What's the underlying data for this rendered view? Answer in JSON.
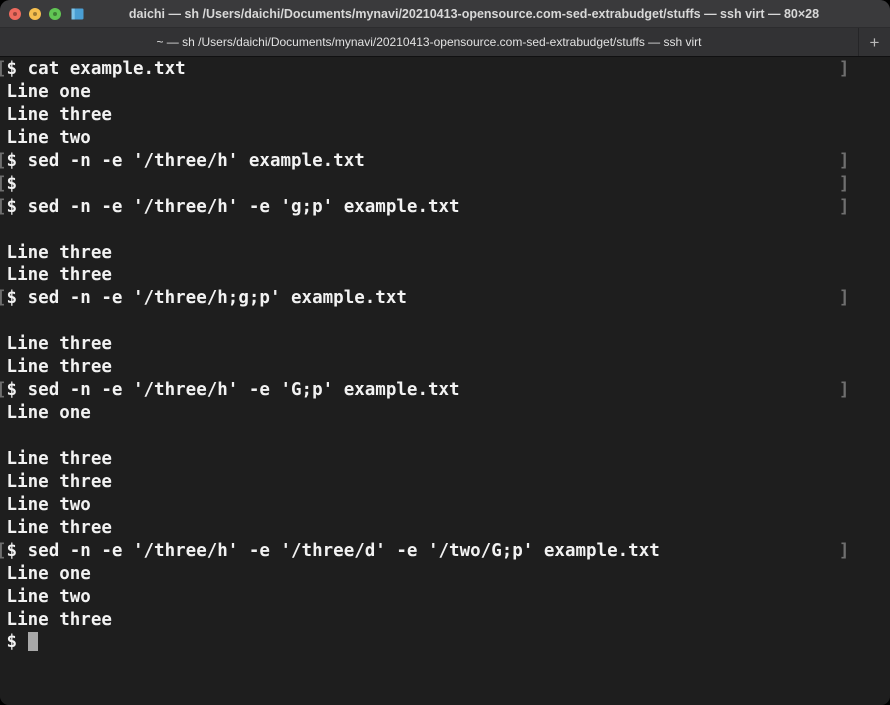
{
  "window": {
    "title": "daichi — sh /Users/daichi/Documents/mynavi/20210413-opensource.com-sed-extrabudget/stuffs — ssh virt — 80×28",
    "traffic_lights": {
      "close_label": "Close",
      "minimize_label": "Minimize",
      "maximize_label": "Zoom"
    },
    "proxy_icon": "folder-icon"
  },
  "tabbar": {
    "tabs": [
      {
        "label": "~ — sh /Users/daichi/Documents/mynavi/20210413-opensource.com-sed-extrabudget/stuffs — ssh virt",
        "active": true
      }
    ],
    "new_tab_label": "+"
  },
  "terminal": {
    "background_color": "#1e1e1e",
    "foreground_color": "#f2f2f2",
    "cursor_color": "#a8a8a8",
    "bracket_color": "#6f6f6f",
    "size": "80×28",
    "lines": [
      {
        "left": "[",
        "text": "$ cat example.txt",
        "right": "]"
      },
      {
        "left": "",
        "text": "Line one",
        "right": ""
      },
      {
        "left": "",
        "text": "Line three",
        "right": ""
      },
      {
        "left": "",
        "text": "Line two",
        "right": ""
      },
      {
        "left": "[",
        "text": "$ sed -n -e '/three/h' example.txt",
        "right": "]"
      },
      {
        "left": "[",
        "text": "$",
        "right": "]"
      },
      {
        "left": "[",
        "text": "$ sed -n -e '/three/h' -e 'g;p' example.txt",
        "right": "]"
      },
      {
        "left": "",
        "text": "",
        "right": ""
      },
      {
        "left": "",
        "text": "Line three",
        "right": ""
      },
      {
        "left": "",
        "text": "Line three",
        "right": ""
      },
      {
        "left": "[",
        "text": "$ sed -n -e '/three/h;g;p' example.txt",
        "right": "]"
      },
      {
        "left": "",
        "text": "",
        "right": ""
      },
      {
        "left": "",
        "text": "Line three",
        "right": ""
      },
      {
        "left": "",
        "text": "Line three",
        "right": ""
      },
      {
        "left": "[",
        "text": "$ sed -n -e '/three/h' -e 'G;p' example.txt",
        "right": "]"
      },
      {
        "left": "",
        "text": "Line one",
        "right": ""
      },
      {
        "left": "",
        "text": "",
        "right": ""
      },
      {
        "left": "",
        "text": "Line three",
        "right": ""
      },
      {
        "left": "",
        "text": "Line three",
        "right": ""
      },
      {
        "left": "",
        "text": "Line two",
        "right": ""
      },
      {
        "left": "",
        "text": "Line three",
        "right": ""
      },
      {
        "left": "[",
        "text": "$ sed -n -e '/three/h' -e '/three/d' -e '/two/G;p' example.txt",
        "right": "]"
      },
      {
        "left": "",
        "text": "Line one",
        "right": ""
      },
      {
        "left": "",
        "text": "Line two",
        "right": ""
      },
      {
        "left": "",
        "text": "Line three",
        "right": ""
      }
    ],
    "prompt": "$ ",
    "cursor_visible": true
  }
}
